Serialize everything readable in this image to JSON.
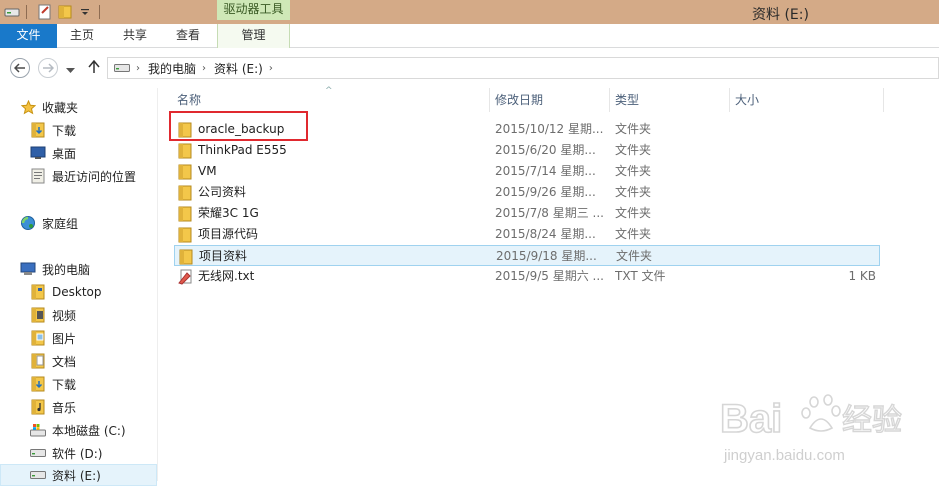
{
  "window": {
    "title": "资料 (E:)",
    "context_tab": "驱动器工具"
  },
  "ribbon_tabs": [
    {
      "label": "文件"
    },
    {
      "label": "主页"
    },
    {
      "label": "共享"
    },
    {
      "label": "查看"
    },
    {
      "label": "管理"
    }
  ],
  "address": {
    "crumbs": [
      "我的电脑",
      "资料 (E:)"
    ]
  },
  "sidebar": {
    "items": [
      {
        "label": "收藏夹",
        "icon": "star-icon"
      },
      {
        "label": "下载",
        "icon": "download-folder-icon"
      },
      {
        "label": "桌面",
        "icon": "desktop-icon"
      },
      {
        "label": "最近访问的位置",
        "icon": "recent-places-icon"
      },
      {
        "label": "家庭组",
        "icon": "homegroup-icon"
      },
      {
        "label": "我的电脑",
        "icon": "computer-icon"
      },
      {
        "label": "Desktop",
        "icon": "folder-icon"
      },
      {
        "label": "视频",
        "icon": "video-folder-icon"
      },
      {
        "label": "图片",
        "icon": "pictures-folder-icon"
      },
      {
        "label": "文档",
        "icon": "documents-folder-icon"
      },
      {
        "label": "下载",
        "icon": "download-folder-icon"
      },
      {
        "label": "音乐",
        "icon": "music-folder-icon"
      },
      {
        "label": "本地磁盘 (C:)",
        "icon": "system-drive-icon"
      },
      {
        "label": "软件 (D:)",
        "icon": "drive-icon"
      },
      {
        "label": "资料 (E:)",
        "icon": "drive-icon"
      }
    ]
  },
  "columns": {
    "name": "名称",
    "date": "修改日期",
    "type": "类型",
    "size": "大小"
  },
  "files": [
    {
      "name": "oracle_backup",
      "date": "2015/10/12 星期...",
      "type": "文件夹",
      "size": "",
      "icon": "folder-icon"
    },
    {
      "name": "ThinkPad E555",
      "date": "2015/6/20 星期...",
      "type": "文件夹",
      "size": "",
      "icon": "folder-icon"
    },
    {
      "name": "VM",
      "date": "2015/7/14 星期...",
      "type": "文件夹",
      "size": "",
      "icon": "folder-icon"
    },
    {
      "name": "公司资料",
      "date": "2015/9/26 星期...",
      "type": "文件夹",
      "size": "",
      "icon": "folder-icon"
    },
    {
      "name": "荣耀3C 1G",
      "date": "2015/7/8 星期三 ...",
      "type": "文件夹",
      "size": "",
      "icon": "folder-icon"
    },
    {
      "name": "项目源代码",
      "date": "2015/8/24 星期...",
      "type": "文件夹",
      "size": "",
      "icon": "folder-icon"
    },
    {
      "name": "项目资料",
      "date": "2015/9/18 星期...",
      "type": "文件夹",
      "size": "",
      "icon": "folder-icon"
    },
    {
      "name": "无线网.txt",
      "date": "2015/9/5 星期六 ...",
      "type": "TXT 文件",
      "size": "1 KB",
      "icon": "text-file-icon"
    }
  ],
  "watermark": {
    "brand": "Bai",
    "brand_end": "经验",
    "url": "jingyan.baidu.com"
  },
  "colors": {
    "file_tab": "#1979ca",
    "titlebar": "#d4aa87",
    "context_tab": "#cfe8b7",
    "selection": "#e5f3fb",
    "highlight": "#e0292f"
  }
}
